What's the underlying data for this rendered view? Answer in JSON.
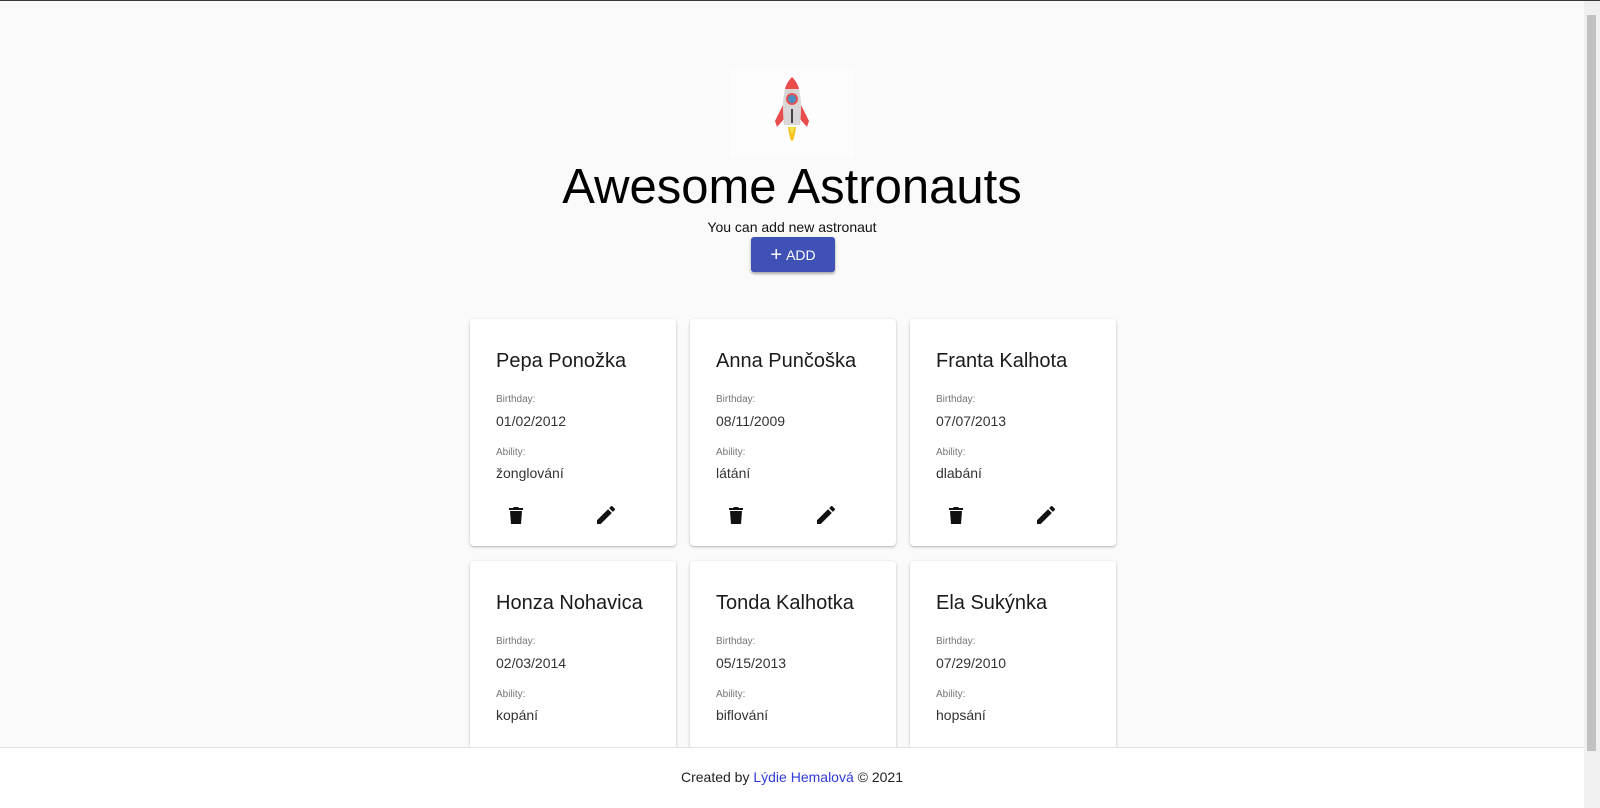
{
  "header": {
    "logo_icon": "rocket-icon",
    "title": "Awesome Astronauts",
    "subtitle": "You can add new astronaut",
    "add_button_label": "ADD",
    "add_button_icon": "plus-icon",
    "accent_color": "#3f51b5"
  },
  "labels": {
    "birthday": "Birthday:",
    "ability": "Ability:"
  },
  "icons": {
    "delete": "trash-icon",
    "edit": "pencil-icon"
  },
  "astronauts": [
    {
      "name": "Pepa Ponožka",
      "birthday": "01/02/2012",
      "ability": "žonglování"
    },
    {
      "name": "Anna Punčoška",
      "birthday": "08/11/2009",
      "ability": "látání"
    },
    {
      "name": "Franta Kalhota",
      "birthday": "07/07/2013",
      "ability": "dlabání"
    },
    {
      "name": "Honza Nohavica",
      "birthday": "02/03/2014",
      "ability": "kopání"
    },
    {
      "name": "Tonda Kalhotka",
      "birthday": "05/15/2013",
      "ability": "biflování"
    },
    {
      "name": "Ela Sukýnka",
      "birthday": "07/29/2010",
      "ability": "hopsání"
    }
  ],
  "footer": {
    "prefix": "Created by",
    "author": "Lýdie Hemalová",
    "suffix": "© 2021"
  }
}
